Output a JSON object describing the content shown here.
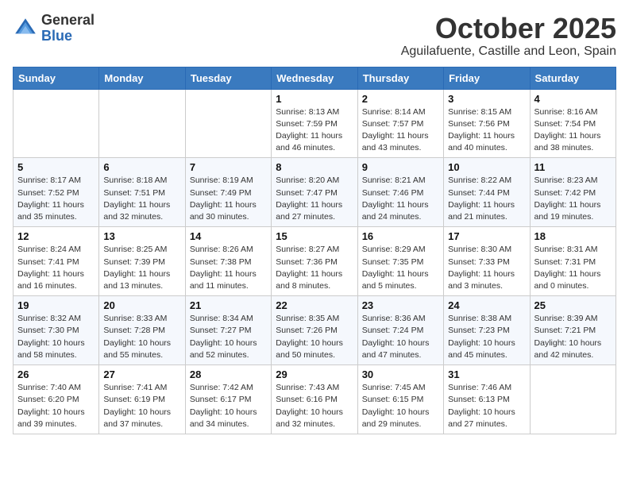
{
  "header": {
    "logo_general": "General",
    "logo_blue": "Blue",
    "month_title": "October 2025",
    "location": "Aguilafuente, Castille and Leon, Spain"
  },
  "days_of_week": [
    "Sunday",
    "Monday",
    "Tuesday",
    "Wednesday",
    "Thursday",
    "Friday",
    "Saturday"
  ],
  "weeks": [
    [
      {
        "day": "",
        "info": ""
      },
      {
        "day": "",
        "info": ""
      },
      {
        "day": "",
        "info": ""
      },
      {
        "day": "1",
        "info": "Sunrise: 8:13 AM\nSunset: 7:59 PM\nDaylight: 11 hours and 46 minutes."
      },
      {
        "day": "2",
        "info": "Sunrise: 8:14 AM\nSunset: 7:57 PM\nDaylight: 11 hours and 43 minutes."
      },
      {
        "day": "3",
        "info": "Sunrise: 8:15 AM\nSunset: 7:56 PM\nDaylight: 11 hours and 40 minutes."
      },
      {
        "day": "4",
        "info": "Sunrise: 8:16 AM\nSunset: 7:54 PM\nDaylight: 11 hours and 38 minutes."
      }
    ],
    [
      {
        "day": "5",
        "info": "Sunrise: 8:17 AM\nSunset: 7:52 PM\nDaylight: 11 hours and 35 minutes."
      },
      {
        "day": "6",
        "info": "Sunrise: 8:18 AM\nSunset: 7:51 PM\nDaylight: 11 hours and 32 minutes."
      },
      {
        "day": "7",
        "info": "Sunrise: 8:19 AM\nSunset: 7:49 PM\nDaylight: 11 hours and 30 minutes."
      },
      {
        "day": "8",
        "info": "Sunrise: 8:20 AM\nSunset: 7:47 PM\nDaylight: 11 hours and 27 minutes."
      },
      {
        "day": "9",
        "info": "Sunrise: 8:21 AM\nSunset: 7:46 PM\nDaylight: 11 hours and 24 minutes."
      },
      {
        "day": "10",
        "info": "Sunrise: 8:22 AM\nSunset: 7:44 PM\nDaylight: 11 hours and 21 minutes."
      },
      {
        "day": "11",
        "info": "Sunrise: 8:23 AM\nSunset: 7:42 PM\nDaylight: 11 hours and 19 minutes."
      }
    ],
    [
      {
        "day": "12",
        "info": "Sunrise: 8:24 AM\nSunset: 7:41 PM\nDaylight: 11 hours and 16 minutes."
      },
      {
        "day": "13",
        "info": "Sunrise: 8:25 AM\nSunset: 7:39 PM\nDaylight: 11 hours and 13 minutes."
      },
      {
        "day": "14",
        "info": "Sunrise: 8:26 AM\nSunset: 7:38 PM\nDaylight: 11 hours and 11 minutes."
      },
      {
        "day": "15",
        "info": "Sunrise: 8:27 AM\nSunset: 7:36 PM\nDaylight: 11 hours and 8 minutes."
      },
      {
        "day": "16",
        "info": "Sunrise: 8:29 AM\nSunset: 7:35 PM\nDaylight: 11 hours and 5 minutes."
      },
      {
        "day": "17",
        "info": "Sunrise: 8:30 AM\nSunset: 7:33 PM\nDaylight: 11 hours and 3 minutes."
      },
      {
        "day": "18",
        "info": "Sunrise: 8:31 AM\nSunset: 7:31 PM\nDaylight: 11 hours and 0 minutes."
      }
    ],
    [
      {
        "day": "19",
        "info": "Sunrise: 8:32 AM\nSunset: 7:30 PM\nDaylight: 10 hours and 58 minutes."
      },
      {
        "day": "20",
        "info": "Sunrise: 8:33 AM\nSunset: 7:28 PM\nDaylight: 10 hours and 55 minutes."
      },
      {
        "day": "21",
        "info": "Sunrise: 8:34 AM\nSunset: 7:27 PM\nDaylight: 10 hours and 52 minutes."
      },
      {
        "day": "22",
        "info": "Sunrise: 8:35 AM\nSunset: 7:26 PM\nDaylight: 10 hours and 50 minutes."
      },
      {
        "day": "23",
        "info": "Sunrise: 8:36 AM\nSunset: 7:24 PM\nDaylight: 10 hours and 47 minutes."
      },
      {
        "day": "24",
        "info": "Sunrise: 8:38 AM\nSunset: 7:23 PM\nDaylight: 10 hours and 45 minutes."
      },
      {
        "day": "25",
        "info": "Sunrise: 8:39 AM\nSunset: 7:21 PM\nDaylight: 10 hours and 42 minutes."
      }
    ],
    [
      {
        "day": "26",
        "info": "Sunrise: 7:40 AM\nSunset: 6:20 PM\nDaylight: 10 hours and 39 minutes."
      },
      {
        "day": "27",
        "info": "Sunrise: 7:41 AM\nSunset: 6:19 PM\nDaylight: 10 hours and 37 minutes."
      },
      {
        "day": "28",
        "info": "Sunrise: 7:42 AM\nSunset: 6:17 PM\nDaylight: 10 hours and 34 minutes."
      },
      {
        "day": "29",
        "info": "Sunrise: 7:43 AM\nSunset: 6:16 PM\nDaylight: 10 hours and 32 minutes."
      },
      {
        "day": "30",
        "info": "Sunrise: 7:45 AM\nSunset: 6:15 PM\nDaylight: 10 hours and 29 minutes."
      },
      {
        "day": "31",
        "info": "Sunrise: 7:46 AM\nSunset: 6:13 PM\nDaylight: 10 hours and 27 minutes."
      },
      {
        "day": "",
        "info": ""
      }
    ]
  ]
}
